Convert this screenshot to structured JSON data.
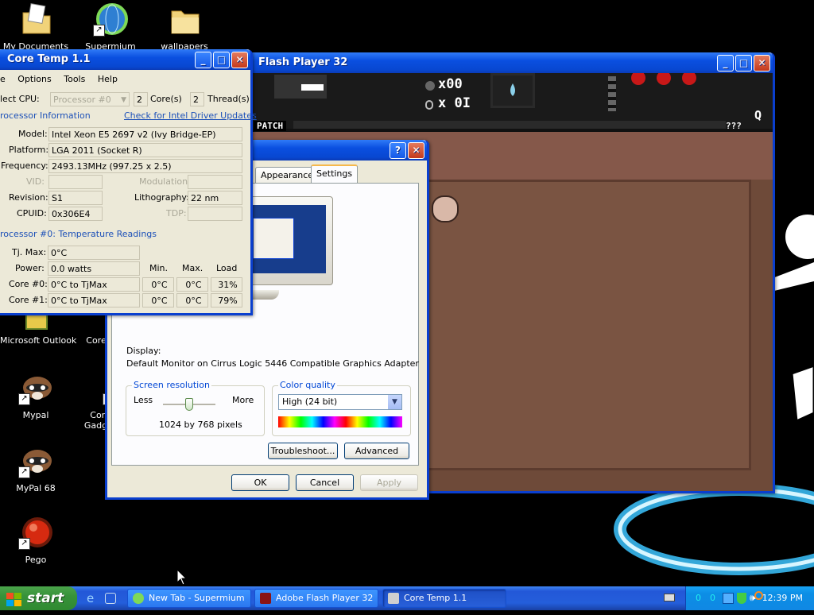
{
  "desktop": {
    "icons": [
      {
        "label": "My Documents"
      },
      {
        "label": "Supermium"
      },
      {
        "label": "wallpapers"
      },
      {
        "label": "Microsoft Outlook"
      },
      {
        "label": "Core"
      },
      {
        "label": "Mypal"
      },
      {
        "label": "Core Gadget"
      },
      {
        "label": "MyPal 68"
      },
      {
        "label": "Pego"
      }
    ]
  },
  "flash_window": {
    "title": "Flash Player 32",
    "hud": {
      "bombs": "x00",
      "keys": "x 0I",
      "patch_label": "PATCH",
      "unknown_item": "???",
      "side_letter": "Q"
    }
  },
  "core_temp": {
    "title": "Core Temp 1.1",
    "menu": [
      "e",
      "Options",
      "Tools",
      "Help"
    ],
    "select_cpu_label": "lect CPU:",
    "processor_select": "Processor #0",
    "cores_value": "2",
    "cores_label": "Core(s)",
    "threads_value": "2",
    "threads_label": "Thread(s)",
    "proc_info_label": "rocessor Information",
    "driver_link": "Check for Intel Driver Updates",
    "model_label": "Model:",
    "model_value": "Intel Xeon E5 2697 v2 (Ivy Bridge-EP)",
    "platform_label": "Platform:",
    "platform_value": "LGA 2011 (Socket R)",
    "frequency_label": "Frequency:",
    "frequency_value": "2493.13MHz (997.25 x 2.5)",
    "vid_label": "VID:",
    "modulation_label": "Modulation:",
    "revision_label": "Revision:",
    "revision_value": "S1",
    "lithography_label": "Lithography:",
    "lithography_value": "22 nm",
    "cpuid_label": "CPUID:",
    "cpuid_value": "0x306E4",
    "tdp_label": "TDP:",
    "temp_label": "rocessor #0: Temperature Readings",
    "tjmax_label": "Tj. Max:",
    "tjmax_value": "0°C",
    "power_label": "Power:",
    "power_value": "0.0 watts",
    "col_min": "Min.",
    "col_max": "Max.",
    "col_load": "Load",
    "cores": [
      {
        "label": "Core #0:",
        "temp": "0°C to TjMax",
        "min": "0°C",
        "max": "0°C",
        "load": "31%"
      },
      {
        "label": "Core #1:",
        "temp": "0°C to TjMax",
        "min": "0°C",
        "max": "0°C",
        "load": "79%"
      }
    ]
  },
  "display_props": {
    "tabs": [
      "Appearance",
      "Settings"
    ],
    "display_label": "Display:",
    "display_value": "Default Monitor on Cirrus Logic 5446 Compatible Graphics Adapter",
    "resolution_group": "Screen resolution",
    "less_label": "Less",
    "more_label": "More",
    "resolution_value": "1024 by 768 pixels",
    "resolution_slider_fraction": 0.5,
    "color_group": "Color quality",
    "color_value": "High (24 bit)",
    "troubleshoot": "Troubleshoot...",
    "advanced": "Advanced",
    "ok": "OK",
    "cancel": "Cancel",
    "apply": "Apply"
  },
  "taskbar": {
    "start": "start",
    "tasks": [
      {
        "label": "New Tab - Supermium"
      },
      {
        "label": "Adobe Flash Player 32"
      },
      {
        "label": "Core Temp 1.1"
      }
    ],
    "tray_values": [
      "0",
      "0"
    ],
    "clock": "12:39 PM"
  },
  "colors": {
    "xp_blue": "#0a4fe0",
    "window_face": "#ece9d8",
    "game_floor": "#7a5442",
    "link_blue": "#1c50b8"
  }
}
